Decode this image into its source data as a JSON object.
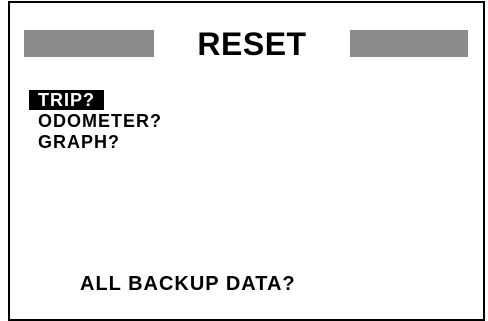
{
  "screen": {
    "title": "RESET",
    "menu_items": [
      {
        "label": "TRIP?",
        "selected": true
      },
      {
        "label": "ODOMETER?",
        "selected": false
      },
      {
        "label": "GRAPH?",
        "selected": false
      }
    ],
    "backup_label": "ALL BACKUP DATA?"
  },
  "colors": {
    "foreground": "#000000",
    "background": "#ffffff",
    "title_bar": "#8c8c8c"
  }
}
